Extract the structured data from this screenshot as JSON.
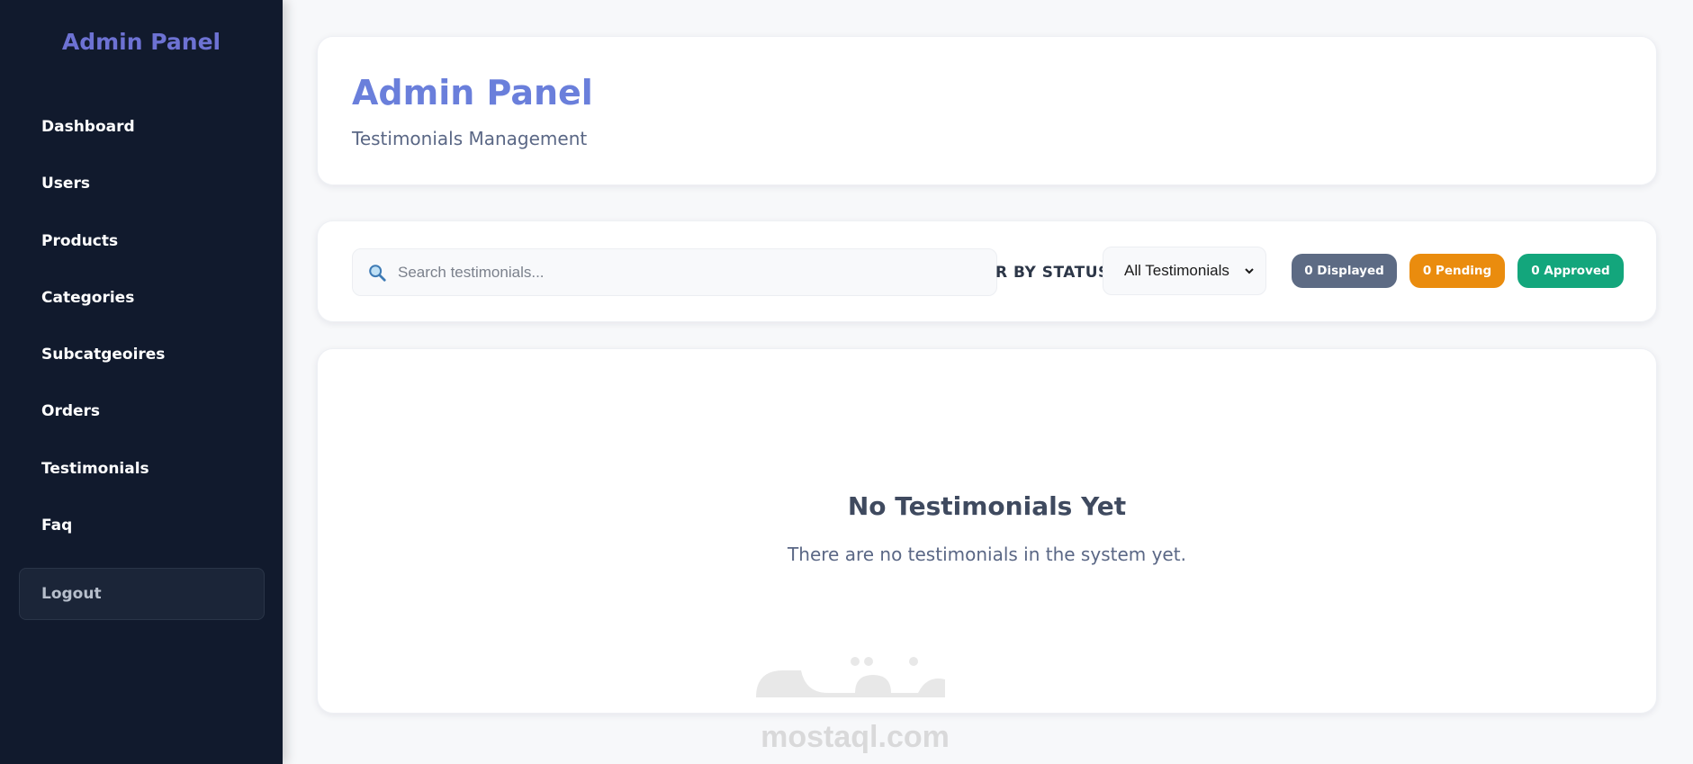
{
  "sidebar": {
    "title": "Admin Panel",
    "items": [
      {
        "label": "Dashboard"
      },
      {
        "label": "Users"
      },
      {
        "label": "Products"
      },
      {
        "label": "Categories"
      },
      {
        "label": "Subcatgeoires"
      },
      {
        "label": "Orders"
      },
      {
        "label": "Testimonials"
      },
      {
        "label": "Faq"
      }
    ],
    "logout_label": "Logout"
  },
  "header": {
    "title": "Admin Panel",
    "subtitle": "Testimonials Management"
  },
  "filters": {
    "search_placeholder": "Search testimonials...",
    "search_value": "",
    "status_label": "R BY STATUS",
    "status_selected": "All Testimonials",
    "badges": {
      "displayed": "0 Displayed",
      "pending": "0 Pending",
      "approved": "0 Approved"
    }
  },
  "empty_state": {
    "title": "No Testimonials Yet",
    "message": "There are no testimonials in the system yet."
  },
  "watermark": {
    "text": "mostaql.com"
  },
  "colors": {
    "sidebar_bg": "#111a2d",
    "accent": "#6a7fdb",
    "badge_displayed": "#5d6b84",
    "badge_pending": "#ea8c0e",
    "badge_approved": "#13a67c"
  },
  "icons": {
    "search": "search-icon",
    "select": "chevron-down-icon"
  }
}
